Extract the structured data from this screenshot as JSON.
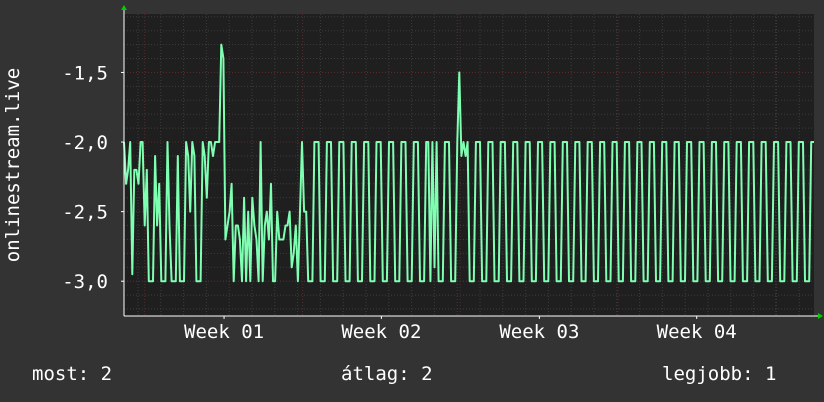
{
  "colors": {
    "background": "#333333",
    "plot_background": "#1f1f1f",
    "line": "#7fffb2",
    "grid_minor": "#3c3c3c",
    "grid_major": "#5a2a2a",
    "axis": "#ffffff",
    "arrow": "#00cc00"
  },
  "stats": {
    "now_label": "most:",
    "now_value": "2",
    "avg_label": "átlag:",
    "avg_value": "2",
    "best_label": "legjobb:",
    "best_value": "1"
  },
  "chart_data": {
    "type": "line",
    "title": "",
    "ylabel": "onlinestream.live",
    "xlabel": "",
    "y_ticks": [
      -1.5,
      -2.0,
      -2.5,
      -3.0
    ],
    "y_tick_labels": [
      "-1,5",
      "-2,0",
      "-2,5",
      "-3,0"
    ],
    "ylim": [
      -3.25,
      -1.08
    ],
    "xlim": [
      0,
      100
    ],
    "x_ticks": [
      14.5,
      37.3,
      60.2,
      83.0
    ],
    "x_tick_labels": [
      "Week 01",
      "Week 02",
      "Week 03",
      "Week 04"
    ],
    "x_major_grid": [
      3,
      25.9,
      48.7,
      71.6,
      94.4
    ],
    "grid": true,
    "series": [
      {
        "points": [
          [
            0.0,
            -2.0
          ],
          [
            0.3,
            -2.3
          ],
          [
            0.6,
            -2.2
          ],
          [
            0.9,
            -2.0
          ],
          [
            1.2,
            -2.95
          ],
          [
            1.5,
            -2.2
          ],
          [
            1.8,
            -2.2
          ],
          [
            2.1,
            -2.3
          ],
          [
            2.4,
            -2.0
          ],
          [
            2.7,
            -2.0
          ],
          [
            3.0,
            -2.6
          ],
          [
            3.3,
            -2.2
          ],
          [
            3.6,
            -3.0
          ],
          [
            4.2,
            -3.0
          ],
          [
            4.5,
            -2.1
          ],
          [
            4.8,
            -2.6
          ],
          [
            5.1,
            -2.3
          ],
          [
            5.4,
            -3.0
          ],
          [
            6.0,
            -3.0
          ],
          [
            6.3,
            -2.0
          ],
          [
            6.6,
            -2.6
          ],
          [
            6.9,
            -3.0
          ],
          [
            7.5,
            -3.0
          ],
          [
            7.8,
            -2.1
          ],
          [
            8.1,
            -3.0
          ],
          [
            8.7,
            -3.0
          ],
          [
            9.0,
            -2.0
          ],
          [
            9.3,
            -2.1
          ],
          [
            9.6,
            -2.5
          ],
          [
            9.9,
            -2.0
          ],
          [
            10.2,
            -2.1
          ],
          [
            10.5,
            -3.0
          ],
          [
            11.1,
            -3.0
          ],
          [
            11.4,
            -2.0
          ],
          [
            11.7,
            -2.1
          ],
          [
            12.0,
            -2.4
          ],
          [
            12.3,
            -2.0
          ],
          [
            12.6,
            -2.0
          ],
          [
            12.9,
            -2.1
          ],
          [
            13.2,
            -2.0
          ],
          [
            13.5,
            -2.0
          ],
          [
            13.8,
            -2.0
          ],
          [
            14.1,
            -1.3
          ],
          [
            14.4,
            -1.4
          ],
          [
            14.7,
            -2.7
          ],
          [
            15.0,
            -2.6
          ],
          [
            15.3,
            -2.5
          ],
          [
            15.6,
            -2.3
          ],
          [
            15.9,
            -3.0
          ],
          [
            16.2,
            -2.6
          ],
          [
            16.5,
            -2.6
          ],
          [
            16.8,
            -2.7
          ],
          [
            17.1,
            -3.0
          ],
          [
            17.4,
            -2.4
          ],
          [
            17.7,
            -3.0
          ],
          [
            18.0,
            -2.5
          ],
          [
            18.3,
            -3.0
          ],
          [
            18.6,
            -2.4
          ],
          [
            18.9,
            -2.6
          ],
          [
            19.2,
            -2.7
          ],
          [
            19.5,
            -3.0
          ],
          [
            19.8,
            -2.0
          ],
          [
            20.1,
            -3.0
          ],
          [
            20.4,
            -2.6
          ],
          [
            20.7,
            -2.5
          ],
          [
            21.0,
            -2.7
          ],
          [
            21.3,
            -2.3
          ],
          [
            21.6,
            -3.0
          ],
          [
            21.9,
            -3.0
          ],
          [
            22.2,
            -2.5
          ],
          [
            22.5,
            -2.7
          ],
          [
            22.8,
            -2.7
          ],
          [
            23.1,
            -2.7
          ],
          [
            23.4,
            -2.6
          ],
          [
            23.7,
            -2.6
          ],
          [
            24.0,
            -2.5
          ],
          [
            24.3,
            -2.9
          ],
          [
            24.6,
            -2.8
          ],
          [
            24.9,
            -2.6
          ],
          [
            25.2,
            -3.0
          ],
          [
            25.5,
            -2.5
          ],
          [
            25.8,
            -2.0
          ],
          [
            26.1,
            -2.5
          ],
          [
            26.4,
            -2.5
          ],
          [
            26.7,
            -3.0
          ],
          [
            27.3,
            -3.0
          ],
          [
            27.6,
            -2.0
          ],
          [
            28.2,
            -2.0
          ],
          [
            28.5,
            -3.0
          ],
          [
            29.1,
            -3.0
          ],
          [
            29.4,
            -2.0
          ],
          [
            30.0,
            -2.0
          ],
          [
            30.3,
            -3.0
          ],
          [
            30.9,
            -3.0
          ],
          [
            31.2,
            -2.0
          ],
          [
            31.8,
            -2.0
          ],
          [
            32.1,
            -3.0
          ],
          [
            32.7,
            -3.0
          ],
          [
            33.0,
            -2.0
          ],
          [
            33.6,
            -2.0
          ],
          [
            33.9,
            -3.0
          ],
          [
            34.5,
            -3.0
          ],
          [
            34.8,
            -2.0
          ],
          [
            35.4,
            -2.0
          ],
          [
            35.7,
            -3.0
          ],
          [
            36.3,
            -3.0
          ],
          [
            36.6,
            -2.0
          ],
          [
            37.2,
            -2.0
          ],
          [
            37.5,
            -3.0
          ],
          [
            38.1,
            -3.0
          ],
          [
            38.4,
            -2.0
          ],
          [
            39.0,
            -2.0
          ],
          [
            39.3,
            -3.0
          ],
          [
            39.9,
            -3.0
          ],
          [
            40.2,
            -2.0
          ],
          [
            40.8,
            -2.0
          ],
          [
            41.1,
            -3.0
          ],
          [
            41.7,
            -3.0
          ],
          [
            42.0,
            -2.0
          ],
          [
            42.6,
            -2.0
          ],
          [
            42.9,
            -3.0
          ],
          [
            43.5,
            -3.0
          ],
          [
            43.8,
            -2.0
          ],
          [
            44.1,
            -2.0
          ],
          [
            44.4,
            -3.0
          ],
          [
            44.7,
            -2.0
          ],
          [
            45.0,
            -2.9
          ],
          [
            45.3,
            -2.0
          ],
          [
            45.6,
            -3.0
          ],
          [
            46.2,
            -3.0
          ],
          [
            46.5,
            -2.0
          ],
          [
            47.1,
            -2.0
          ],
          [
            47.4,
            -3.0
          ],
          [
            48.0,
            -3.0
          ],
          [
            48.3,
            -2.0
          ],
          [
            48.6,
            -1.5
          ],
          [
            48.9,
            -2.1
          ],
          [
            49.2,
            -2.0
          ],
          [
            49.5,
            -2.1
          ],
          [
            49.8,
            -2.0
          ],
          [
            50.1,
            -3.0
          ],
          [
            50.7,
            -3.0
          ],
          [
            51.0,
            -2.0
          ],
          [
            51.6,
            -2.0
          ],
          [
            51.9,
            -3.0
          ],
          [
            52.5,
            -3.0
          ],
          [
            52.8,
            -2.0
          ],
          [
            53.4,
            -2.0
          ],
          [
            53.7,
            -3.0
          ],
          [
            54.3,
            -3.0
          ],
          [
            54.6,
            -2.0
          ],
          [
            55.2,
            -2.0
          ],
          [
            55.5,
            -3.0
          ],
          [
            56.1,
            -3.0
          ],
          [
            56.4,
            -2.0
          ],
          [
            57.0,
            -2.0
          ],
          [
            57.3,
            -3.0
          ],
          [
            57.9,
            -3.0
          ],
          [
            58.2,
            -2.0
          ],
          [
            58.8,
            -2.0
          ],
          [
            59.1,
            -3.0
          ],
          [
            59.7,
            -3.0
          ],
          [
            60.0,
            -2.0
          ],
          [
            60.6,
            -2.0
          ],
          [
            60.9,
            -3.0
          ],
          [
            61.5,
            -3.0
          ],
          [
            61.8,
            -2.0
          ],
          [
            62.4,
            -2.0
          ],
          [
            62.7,
            -3.0
          ],
          [
            63.3,
            -3.0
          ],
          [
            63.6,
            -2.0
          ],
          [
            64.2,
            -2.0
          ],
          [
            64.5,
            -3.0
          ],
          [
            65.1,
            -3.0
          ],
          [
            65.4,
            -2.0
          ],
          [
            66.0,
            -2.0
          ],
          [
            66.3,
            -3.0
          ],
          [
            66.9,
            -3.0
          ],
          [
            67.2,
            -2.0
          ],
          [
            67.8,
            -2.0
          ],
          [
            68.1,
            -3.0
          ],
          [
            68.7,
            -3.0
          ],
          [
            69.0,
            -2.0
          ],
          [
            69.6,
            -2.0
          ],
          [
            69.9,
            -3.0
          ],
          [
            70.5,
            -3.0
          ],
          [
            70.8,
            -2.0
          ],
          [
            71.4,
            -2.0
          ],
          [
            71.7,
            -3.0
          ],
          [
            72.3,
            -3.0
          ],
          [
            72.6,
            -2.0
          ],
          [
            73.2,
            -2.0
          ],
          [
            73.5,
            -3.0
          ],
          [
            74.1,
            -3.0
          ],
          [
            74.4,
            -2.0
          ],
          [
            75.0,
            -2.0
          ],
          [
            75.3,
            -3.0
          ],
          [
            75.9,
            -3.0
          ],
          [
            76.2,
            -2.0
          ],
          [
            76.8,
            -2.0
          ],
          [
            77.1,
            -3.0
          ],
          [
            77.7,
            -3.0
          ],
          [
            78.0,
            -2.0
          ],
          [
            78.6,
            -2.0
          ],
          [
            78.9,
            -3.0
          ],
          [
            79.5,
            -3.0
          ],
          [
            79.8,
            -2.0
          ],
          [
            80.4,
            -2.0
          ],
          [
            80.7,
            -3.0
          ],
          [
            81.3,
            -3.0
          ],
          [
            81.6,
            -2.0
          ],
          [
            82.2,
            -2.0
          ],
          [
            82.5,
            -3.0
          ],
          [
            83.1,
            -3.0
          ],
          [
            83.4,
            -2.0
          ],
          [
            84.0,
            -2.0
          ],
          [
            84.3,
            -3.0
          ],
          [
            84.9,
            -3.0
          ],
          [
            85.2,
            -2.0
          ],
          [
            85.8,
            -2.0
          ],
          [
            86.1,
            -3.0
          ],
          [
            86.7,
            -3.0
          ],
          [
            87.0,
            -2.0
          ],
          [
            87.6,
            -2.0
          ],
          [
            87.9,
            -3.0
          ],
          [
            88.5,
            -3.0
          ],
          [
            88.8,
            -2.0
          ],
          [
            89.4,
            -2.0
          ],
          [
            89.7,
            -3.0
          ],
          [
            90.3,
            -3.0
          ],
          [
            90.6,
            -2.0
          ],
          [
            91.2,
            -2.0
          ],
          [
            91.5,
            -3.0
          ],
          [
            92.1,
            -3.0
          ],
          [
            92.4,
            -2.0
          ],
          [
            93.0,
            -2.0
          ],
          [
            93.3,
            -3.0
          ],
          [
            93.9,
            -3.0
          ],
          [
            94.2,
            -2.0
          ],
          [
            94.8,
            -2.0
          ],
          [
            95.1,
            -3.0
          ],
          [
            95.7,
            -3.0
          ],
          [
            96.0,
            -2.0
          ],
          [
            96.6,
            -2.0
          ],
          [
            96.9,
            -3.0
          ],
          [
            97.5,
            -3.0
          ],
          [
            97.8,
            -2.0
          ],
          [
            98.4,
            -2.0
          ],
          [
            98.7,
            -3.0
          ],
          [
            99.3,
            -3.0
          ],
          [
            99.6,
            -2.0
          ],
          [
            100.0,
            -2.0
          ]
        ]
      }
    ]
  }
}
